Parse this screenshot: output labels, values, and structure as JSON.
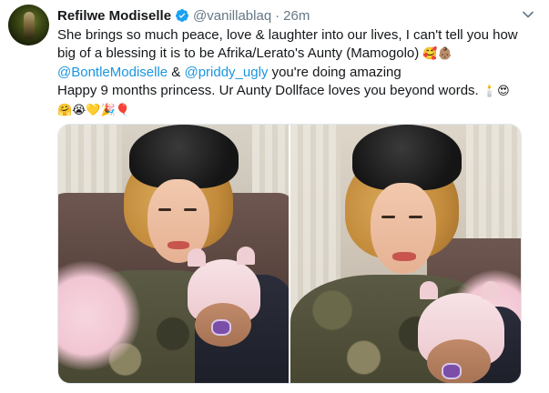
{
  "tweet": {
    "author_name": "Refilwe Modiselle",
    "handle": "@vanillablaq",
    "separator": "·",
    "time": "26m",
    "lines": {
      "l1": "She brings so much peace, love & laughter into our lives, I can't tell you how",
      "l2_text": "big of a blessing it is to be Afrika/Lerato's Aunty (Mamogolo)",
      "l2_emoji": "🥰👶🏽",
      "l3_mention1": "@BontleModiselle",
      "l3_amp": " & ",
      "l3_mention2": "@priddy_ugly",
      "l3_text": " you're doing amazing",
      "l4_text": "Happy 9 months princess. Ur Aunty Dollface loves you beyond words.",
      "l4_emoji": "🕯️😍",
      "l5_emoji": "🤗😭💛🎉🎈"
    }
  },
  "icons": {
    "verified": "verified-badge-icon",
    "caret": "chevron-down-icon"
  },
  "colors": {
    "link": "#1b95e0",
    "secondary": "#657786",
    "verified": "#1da1f2"
  },
  "media": {
    "count": 2
  }
}
